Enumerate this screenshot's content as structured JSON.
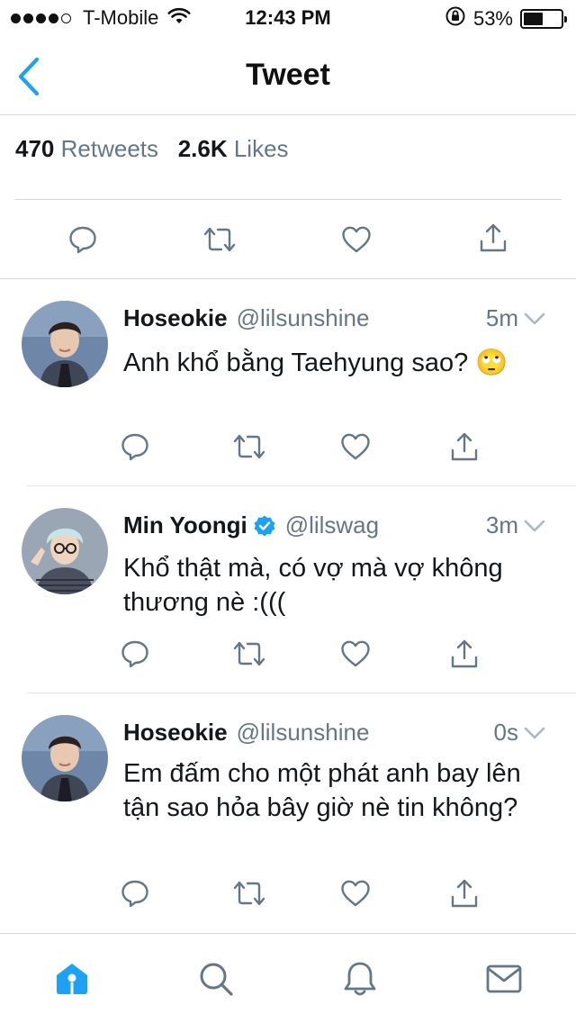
{
  "status_bar": {
    "carrier": "T-Mobile",
    "time": "12:43 PM",
    "battery": "53%",
    "battery_level": 0.53,
    "signal_bars": 4,
    "icons": [
      "wifi-icon",
      "rotation-lock-icon",
      "battery-icon"
    ]
  },
  "nav": {
    "title": "Tweet",
    "back_icon": "chevron-left-icon"
  },
  "stats": {
    "retweets_count": "470",
    "retweets_label": "Retweets",
    "likes_count": "2.6K",
    "likes_label": "Likes"
  },
  "actions": [
    "reply-icon",
    "retweet-icon",
    "like-icon",
    "share-icon"
  ],
  "replies": [
    {
      "name": "Hoseokie",
      "handle": "@lilsunshine",
      "time": "5m",
      "verified": false,
      "text": "Anh khổ bằng Taehyung sao? 🙄"
    },
    {
      "name": "Min Yoongi",
      "handle": "@lilswag",
      "time": "3m",
      "verified": true,
      "text": "Khổ thật mà, có vợ mà vợ không thương nè :((("
    },
    {
      "name": "Hoseokie",
      "handle": "@lilsunshine",
      "time": "0s",
      "verified": false,
      "text": "Em đấm cho một phát anh bay lên tận sao hỏa bây giờ nè tin không?"
    }
  ],
  "tabbar": {
    "items": [
      "home-icon",
      "search-icon",
      "notifications-icon",
      "messages-icon"
    ],
    "active": "home-icon"
  },
  "colors": {
    "accent": "#1da1f2",
    "icon_gray": "#657786",
    "divider": "#d5d8db",
    "text": "#14171a",
    "verified": "#1da1f2"
  }
}
